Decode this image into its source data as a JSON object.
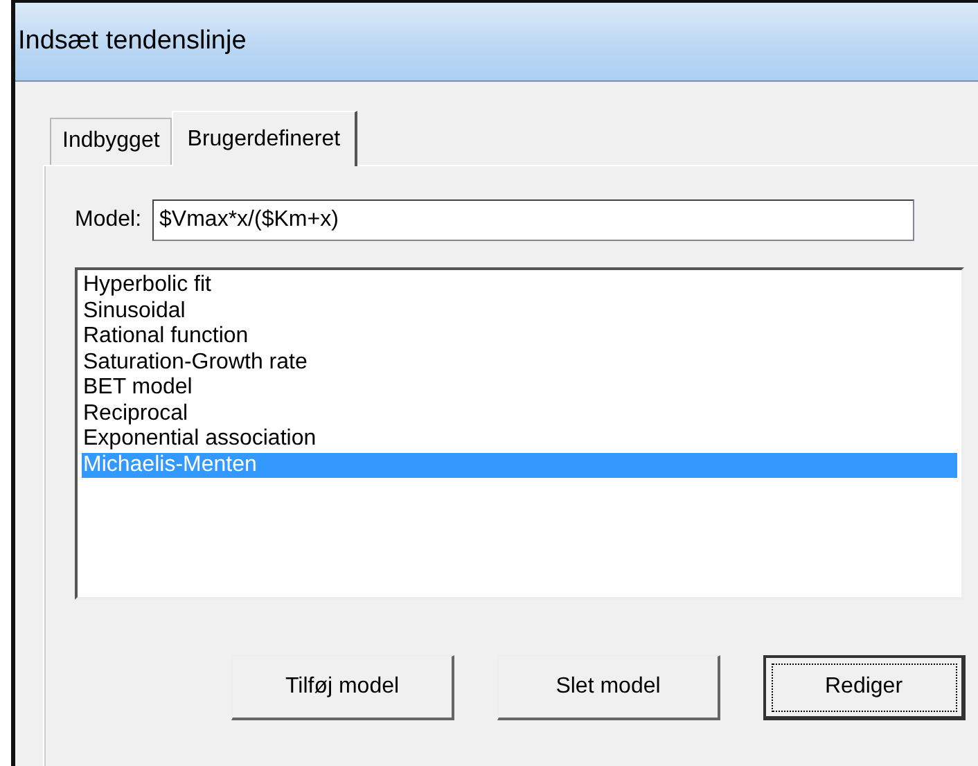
{
  "window": {
    "title": "Indsæt tendenslinje"
  },
  "tabs": [
    {
      "label": "Indbygget",
      "selected": false
    },
    {
      "label": "Brugerdefineret",
      "selected": true
    }
  ],
  "model": {
    "label": "Model:",
    "value": "$Vmax*x/($Km+x)"
  },
  "models": [
    {
      "label": "Hyperbolic fit",
      "selected": false
    },
    {
      "label": "Sinusoidal",
      "selected": false
    },
    {
      "label": "Rational function",
      "selected": false
    },
    {
      "label": "Saturation-Growth rate",
      "selected": false
    },
    {
      "label": "BET model",
      "selected": false
    },
    {
      "label": "Reciprocal",
      "selected": false
    },
    {
      "label": "Exponential association",
      "selected": false
    },
    {
      "label": "Michaelis-Menten",
      "selected": true
    }
  ],
  "buttons": [
    {
      "label": "Tilføj model",
      "focused": false
    },
    {
      "label": "Slet model",
      "focused": false
    },
    {
      "label": "Rediger",
      "focused": true
    }
  ]
}
